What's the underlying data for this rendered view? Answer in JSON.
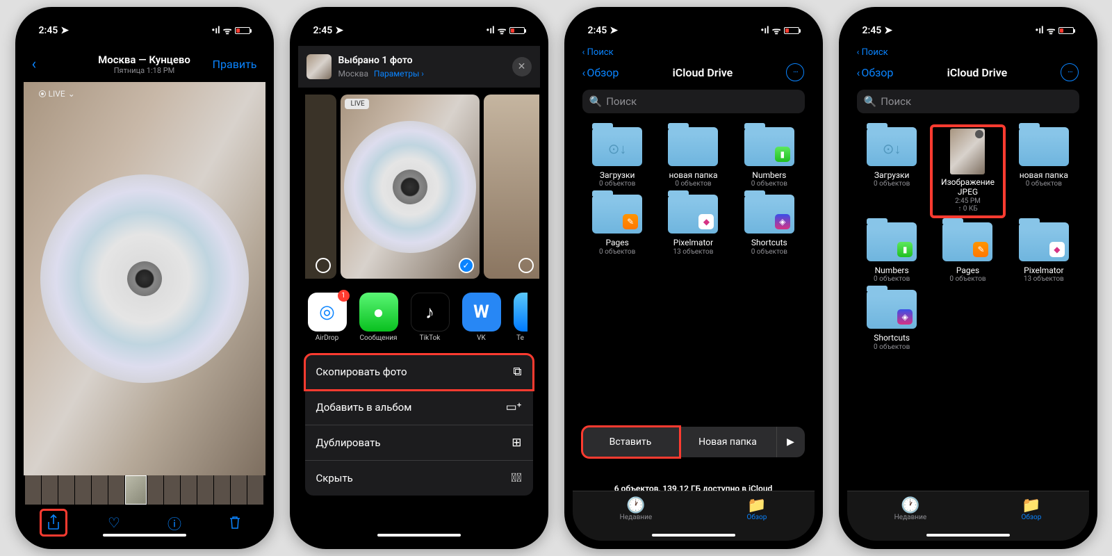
{
  "status": {
    "time": "2:45",
    "location_arrow": "➤"
  },
  "screen1": {
    "title": "Москва — Кунцево",
    "subtitle": "Пятница 1:18 PM",
    "edit": "Править",
    "live": "LIVE"
  },
  "screen2": {
    "selected": "Выбрано 1 фото",
    "location": "Москва",
    "options": "Параметры ›",
    "live": "LIVE",
    "apps": {
      "airdrop": "AirDrop",
      "messages": "Сообщения",
      "tiktok": "TikTok",
      "vk": "VK",
      "telegram_peek": "Te"
    },
    "badge": "1",
    "actions": {
      "copy": "Скопировать фото",
      "add_album": "Добавить в альбом",
      "duplicate": "Дублировать",
      "hide": "Скрыть"
    }
  },
  "files": {
    "back_search": "‹ Поиск",
    "back": "Обзор",
    "title": "iCloud Drive",
    "search": "Поиск",
    "items": {
      "downloads": {
        "name": "Загрузки",
        "meta": "0 объектов"
      },
      "newfolder": {
        "name": "новая папка",
        "meta": "0 объектов"
      },
      "numbers": {
        "name": "Numbers",
        "meta": "0 объектов"
      },
      "pages": {
        "name": "Pages",
        "meta": "0 объектов"
      },
      "pixelmator": {
        "name": "Pixelmator",
        "meta": "13 объектов"
      },
      "shortcuts": {
        "name": "Shortcuts",
        "meta": "0 объектов"
      },
      "image": {
        "name": "Изображение JPEG",
        "time": "2:45 PM",
        "size": "↑ 0 КБ"
      }
    },
    "context": {
      "paste": "Вставить",
      "newfolder": "Новая папка"
    },
    "storage": "6 объектов, 139.12 ГБ доступно в iCloud",
    "tabs": {
      "recent": "Недавние",
      "browse": "Обзор"
    }
  }
}
